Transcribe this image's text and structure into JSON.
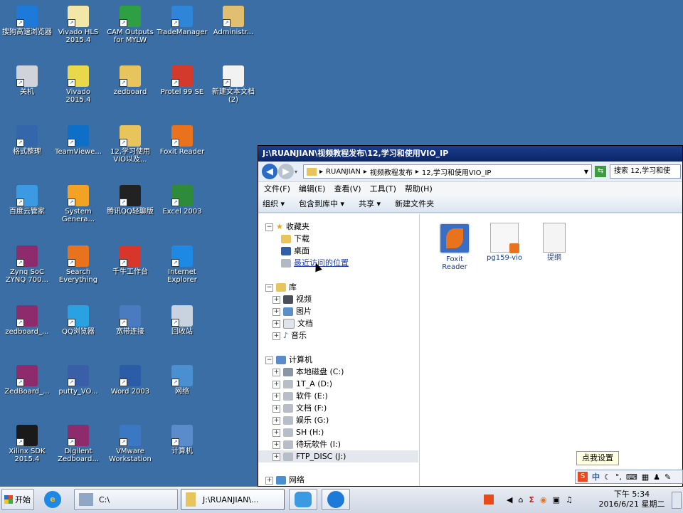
{
  "desktop": {
    "icons": [
      {
        "label": "搜狗高速浏览器",
        "color": "#1e7ad9"
      },
      {
        "label": "Vivado HLS\n2015.4",
        "color": "#f2e7a6"
      },
      {
        "label": "CAM Outputs\nfor MYLW",
        "color": "#2ea043"
      },
      {
        "label": "TradeManager",
        "color": "#2f86d8"
      },
      {
        "label": "Administr...",
        "color": "#e0c070"
      },
      {
        "label": "关机",
        "color": "#d0d4da"
      },
      {
        "label": "Vivado\n2015.4",
        "color": "#e8d84a"
      },
      {
        "label": "zedboard",
        "color": "#e8c45c"
      },
      {
        "label": "Protel 99 SE",
        "color": "#d33a2c"
      },
      {
        "label": "新建文本文档\n(2)",
        "color": "#f2f2f2"
      },
      {
        "label": "格式整理",
        "color": "#3366aa"
      },
      {
        "label": "TeamViewe...",
        "color": "#0e6fc7"
      },
      {
        "label": "12,学习使用\nVIO以及...",
        "color": "#e8c45c"
      },
      {
        "label": "Foxit Reader",
        "color": "#e8731c"
      },
      {
        "label": "百度云管家",
        "color": "#3b9ae1"
      },
      {
        "label": "System\nGenera...",
        "color": "#f2a324"
      },
      {
        "label": "腾讯QQ轻聊版",
        "color": "#222222"
      },
      {
        "label": "Excel 2003",
        "color": "#2e8b3a"
      },
      {
        "label": "Zynq SoC\nZYNQ 700...",
        "color": "#8e2b6d"
      },
      {
        "label": "Search\nEverything",
        "color": "#e8731c"
      },
      {
        "label": "千牛工作台",
        "color": "#d8362a"
      },
      {
        "label": "Internet\nExplorer",
        "color": "#1e88e5"
      },
      {
        "label": "zedboard_...",
        "color": "#8e2b6d"
      },
      {
        "label": "QQ浏览器",
        "color": "#2aa1e0"
      },
      {
        "label": "宽带连接",
        "color": "#4a7bc0"
      },
      {
        "label": "回收站",
        "color": "#c9d3df"
      },
      {
        "label": "ZedBoard_...",
        "color": "#8e2b6d"
      },
      {
        "label": "putty_VO...",
        "color": "#3a5fa8"
      },
      {
        "label": "Word 2003",
        "color": "#2b5ca8"
      },
      {
        "label": "网络",
        "color": "#4a8fd0"
      },
      {
        "label": "Xilinx SDK\n2015.4",
        "color": "#1a1a1a"
      },
      {
        "label": "Digilent\nZedboard...",
        "color": "#8e2b6d"
      },
      {
        "label": "VMware\nWorkstation",
        "color": "#3b78c4"
      },
      {
        "label": "计算机",
        "color": "#5a8ccc"
      }
    ]
  },
  "explorer": {
    "title": "J:\\RUANJIAN\\视频教程发布\\12,学习和使用VIO_IP",
    "breadcrumb": [
      "RUANJIAN",
      "视频教程发布",
      "12,学习和使用VIO_IP"
    ],
    "search_placeholder": "搜索 12,学习和使",
    "menu": [
      "文件(F)",
      "编辑(E)",
      "查看(V)",
      "工具(T)",
      "帮助(H)"
    ],
    "toolbar": [
      "组织 ▾",
      "包含到库中 ▾",
      "共享 ▾",
      "新建文件夹"
    ],
    "nav": {
      "favorites": "收藏夹",
      "fav_items": [
        "下载",
        "桌面",
        "最近访问的位置"
      ],
      "libraries": "库",
      "lib_items": [
        "视频",
        "图片",
        "文档",
        "音乐"
      ],
      "computer": "计算机",
      "drives": [
        "本地磁盘 (C:)",
        "1T_A (D:)",
        "软件 (E:)",
        "文档 (F:)",
        "娱乐 (G:)",
        "SH (H:)",
        "待玩软件 (I:)",
        "FTP_DISC (J:)"
      ],
      "network": "网络"
    },
    "files": [
      {
        "label": "Foxit\nReader"
      },
      {
        "label": "pg159-vio"
      },
      {
        "label": "提纲"
      }
    ]
  },
  "ime": {
    "tooltip": "点我设置",
    "lang": "中"
  },
  "taskbar": {
    "start": "开始",
    "task1": "C:\\",
    "task2": "J:\\RUANJIAN\\...",
    "time": "下午 5:34",
    "date": "2016/6/21 星期二"
  }
}
